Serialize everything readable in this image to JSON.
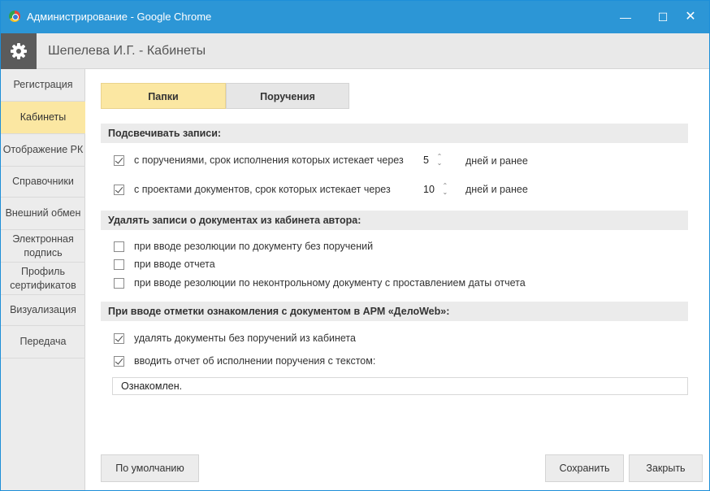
{
  "window": {
    "title": "Администрирование - Google Chrome",
    "controls": {
      "minimize": "—",
      "maximize": "☐",
      "close": "✕"
    }
  },
  "app": {
    "title": "Шепелева И.Г. - Кабинеты"
  },
  "sidebar": {
    "items": [
      {
        "label": "Регистрация"
      },
      {
        "label": "Кабинеты"
      },
      {
        "label": "Отображение РК"
      },
      {
        "label": "Справочники"
      },
      {
        "label": "Внешний обмен"
      },
      {
        "label": "Электронная подпись"
      },
      {
        "label": "Профиль сертификатов"
      },
      {
        "label": "Визуализация"
      },
      {
        "label": "Передача"
      }
    ],
    "active_index": 1
  },
  "tabs": [
    {
      "label": "Папки"
    },
    {
      "label": "Поручения"
    }
  ],
  "highlight": {
    "header": "Подсвечивать записи:",
    "rows": [
      {
        "label": "с поручениями, срок исполнения которых истекает через",
        "checked": true,
        "value": "5",
        "suffix": "дней и ранее"
      },
      {
        "label": "с проектами документов, срок которых истекает через",
        "checked": true,
        "value": "10",
        "suffix": "дней и ранее"
      }
    ]
  },
  "delete": {
    "header": "Удалять записи о документах из кабинета автора:",
    "rows": [
      {
        "label": "при вводе резолюции по документу без поручений",
        "checked": false
      },
      {
        "label": "при вводе отчета",
        "checked": false
      },
      {
        "label": "при вводе резолюции по неконтрольному документу с проставлением даты отчета",
        "checked": false
      }
    ]
  },
  "ack": {
    "header": "При вводе отметки ознакомления с документом в АРМ «ДелоWeb»:",
    "rows": [
      {
        "label": "удалять документы без поручений из кабинета",
        "checked": true
      },
      {
        "label": "вводить отчет об исполнении поручения с текстом:",
        "checked": true
      }
    ],
    "text_value": "Ознакомлен."
  },
  "buttons": {
    "default": "По умолчанию",
    "save": "Сохранить",
    "close": "Закрыть"
  },
  "colors": {
    "titlebar": "#2c96d6",
    "active_accent": "#fbe7a2",
    "panel": "#ececec"
  }
}
